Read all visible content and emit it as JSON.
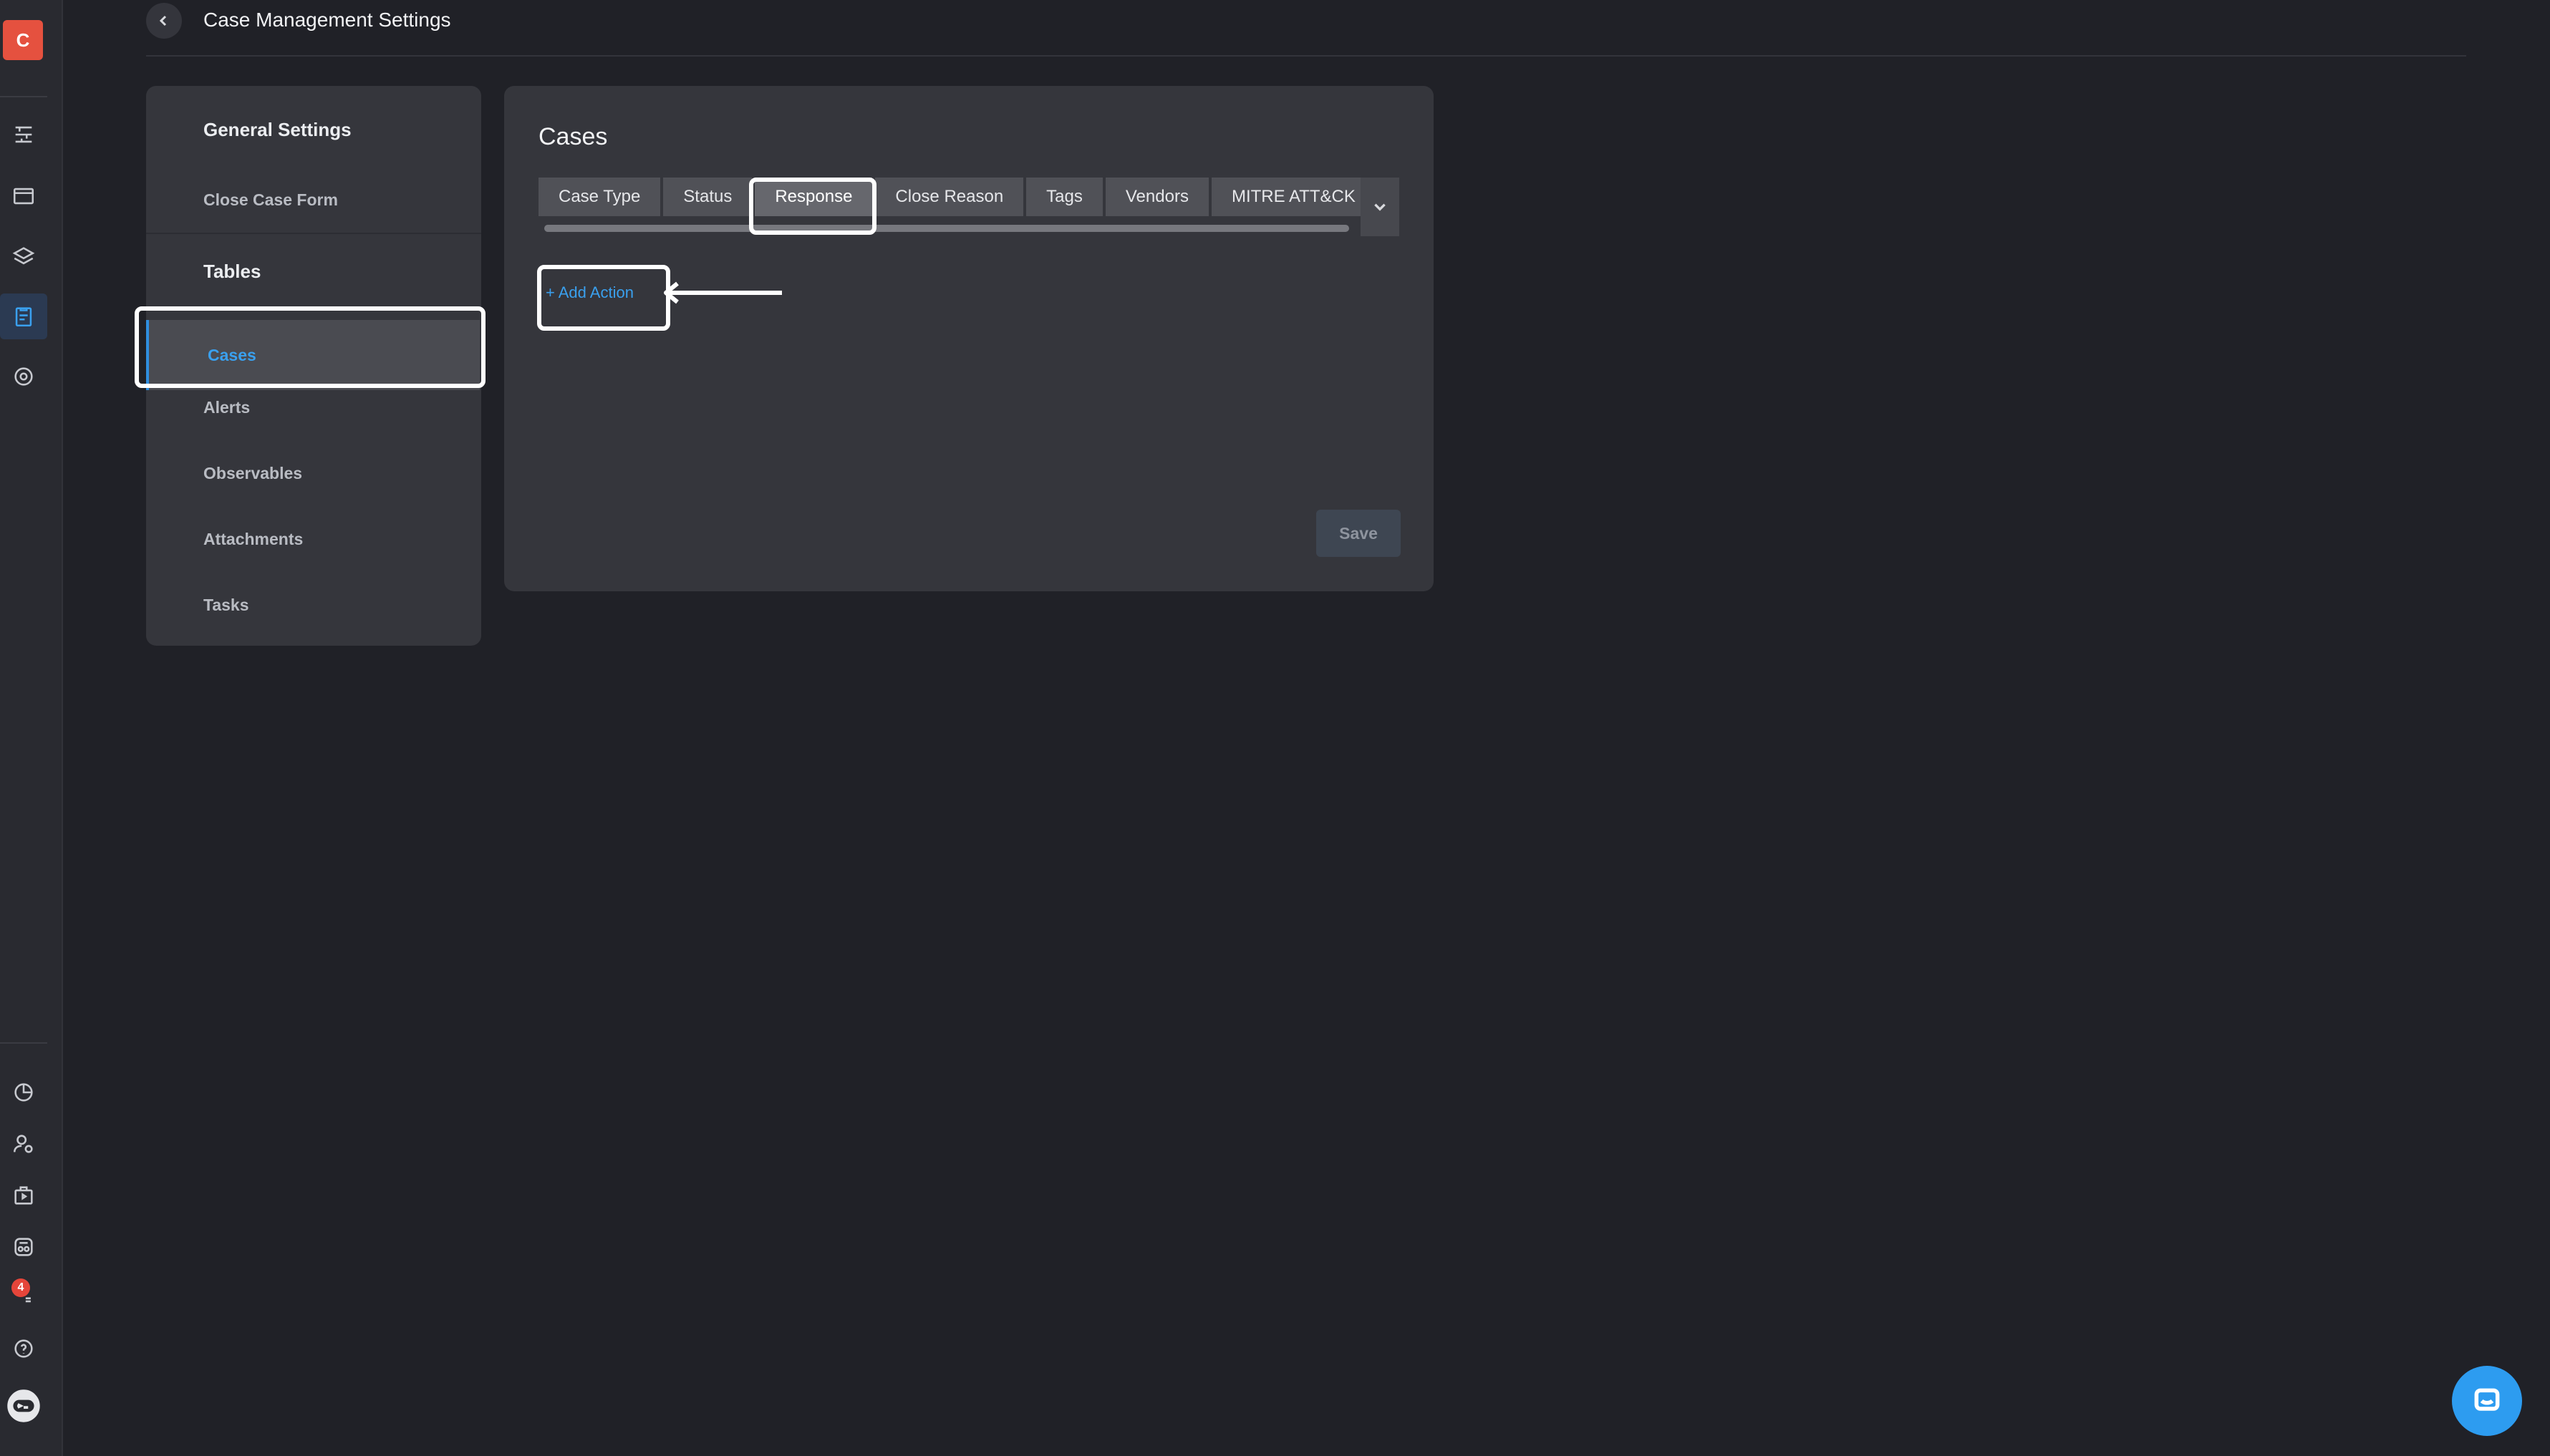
{
  "app": {
    "brand_letter": "C",
    "notification_count": "4"
  },
  "header": {
    "title": "Case Management Settings"
  },
  "settings_nav": {
    "sections": [
      {
        "label": "General Settings",
        "items": [
          "Close Case Form"
        ]
      },
      {
        "label": "Tables",
        "items": [
          "Cases",
          "Alerts",
          "Observables",
          "Attachments",
          "Tasks"
        ]
      }
    ],
    "active_item": "Cases"
  },
  "panel": {
    "title": "Cases",
    "tabs": [
      "Case Type",
      "Status",
      "Response",
      "Close Reason",
      "Tags",
      "Vendors",
      "MITRE ATT&CK"
    ],
    "active_tab": "Response",
    "add_action_label": "+ Add Action",
    "save_label": "Save"
  },
  "colors": {
    "accent": "#3aa0ee",
    "brand": "#e5513f",
    "background": "#202127",
    "panel": "#35363c"
  },
  "icons": {
    "rail_top": [
      "pipeline-icon",
      "window-icon",
      "layers-icon",
      "clipboard-icon",
      "settings-gear-icon"
    ],
    "rail_bottom": [
      "pie-chart-icon",
      "user-settings-icon",
      "briefcase-icon",
      "agent-icon",
      "help-icon",
      "bot-icon"
    ],
    "chat": "chat-icon"
  }
}
